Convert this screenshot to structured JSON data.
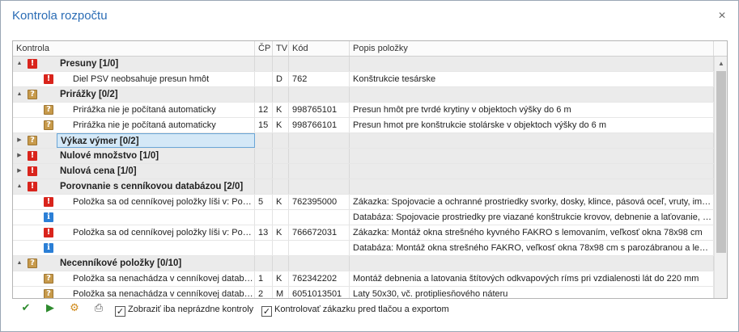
{
  "window": {
    "title": "Kontrola rozpočtu",
    "close_glyph": "×"
  },
  "grid": {
    "columns": [
      "Kontrola",
      "ČP",
      "TV",
      "Kód",
      "Popis položky"
    ],
    "rows": [
      {
        "kind": "group",
        "expand": "▲",
        "icon": "error",
        "text": "Presuny  [1/0]",
        "cp": "",
        "tv": "",
        "kod": "",
        "popis": ""
      },
      {
        "kind": "item",
        "expand": "",
        "icon": "error",
        "text": "Diel PSV neobsahuje presun hmôt",
        "cp": "",
        "tv": "D",
        "kod": "762",
        "popis": "Konštrukcie tesárske"
      },
      {
        "kind": "group",
        "expand": "▲",
        "icon": "warn",
        "text": "Prirážky  [0/2]",
        "cp": "",
        "tv": "",
        "kod": "",
        "popis": ""
      },
      {
        "kind": "item",
        "expand": "",
        "icon": "warn",
        "text": "Prirážka nie je  počítaná automaticky",
        "cp": "12",
        "tv": "K",
        "kod": "998765101",
        "popis": "Presun hmôt pre tvrdé krytiny v objektoch výšky do 6 m"
      },
      {
        "kind": "item",
        "expand": "",
        "icon": "warn",
        "text": "Prirážka nie je  počítaná automaticky",
        "cp": "15",
        "tv": "K",
        "kod": "998766101",
        "popis": "Presun hmot pre konštrukcie stolárske v objektoch výšky do 6 m"
      },
      {
        "kind": "group",
        "expand": "▶",
        "icon": "warn",
        "text": "Výkaz výmer  [0/2]",
        "cp": "",
        "tv": "",
        "kod": "",
        "popis": "",
        "selected": true
      },
      {
        "kind": "group",
        "expand": "▶",
        "icon": "error",
        "text": "Nulové množstvo  [1/0]",
        "cp": "",
        "tv": "",
        "kod": "",
        "popis": ""
      },
      {
        "kind": "group",
        "expand": "▶",
        "icon": "error",
        "text": "Nulová cena  [1/0]",
        "cp": "",
        "tv": "",
        "kod": "",
        "popis": ""
      },
      {
        "kind": "group",
        "expand": "▲",
        "icon": "error",
        "text": "Porovnanie s cenníkovou databázou  [2/0]",
        "cp": "",
        "tv": "",
        "kod": "",
        "popis": ""
      },
      {
        "kind": "item",
        "expand": "",
        "icon": "error",
        "text": "Položka sa od cenníkovej položky líši v: Popis položky",
        "cp": "5",
        "tv": "K",
        "kod": "762395000",
        "popis": "Zákazka: Spojovacie a ochranné prostriedky svorky, dosky, klince, pásová oceľ, vruty, impregnácia"
      },
      {
        "kind": "item",
        "expand": "",
        "icon": "info",
        "text": "",
        "cp": "",
        "tv": "",
        "kod": "",
        "popis": "Databáza: Spojovacie prostriedky  pre viazané konštrukcie krovov, debnenie a laťovanie, nadstrešné konštrukcie"
      },
      {
        "kind": "item",
        "expand": "",
        "icon": "error",
        "text": "Položka sa od cenníkovej položky líši v: Popis položky",
        "cp": "13",
        "tv": "K",
        "kod": "766672031",
        "popis": "Zákazka: Montáž okna strešného kyvného FAKRO s lemovaním, veľkosť okna 78x98 cm"
      },
      {
        "kind": "item",
        "expand": "",
        "icon": "info",
        "text": "",
        "cp": "",
        "tv": "",
        "kod": "",
        "popis": "Databáza: Montáž okna strešného FAKRO, veľkosť okna 78x98 cm s parozábranou a lemovaním"
      },
      {
        "kind": "group",
        "expand": "▲",
        "icon": "warn",
        "text": "Necenníkové položky   [0/10]",
        "cp": "",
        "tv": "",
        "kod": "",
        "popis": ""
      },
      {
        "kind": "item",
        "expand": "",
        "icon": "warn",
        "text": "Položka sa nenachádza v cenníkovej databáze",
        "cp": "1",
        "tv": "K",
        "kod": "762342202",
        "popis": "Montáž debnenia a latovania štítových odkvapových ríms pri vzdialenosti lát do 220 mm"
      },
      {
        "kind": "item",
        "expand": "",
        "icon": "warn",
        "text": "Položka sa nenachádza v cenníkovej databáze",
        "cp": "2",
        "tv": "M",
        "kod": "6051013501",
        "popis": "Laty 50x30, vč. protipliesňového náteru"
      }
    ]
  },
  "icons": {
    "error": "!",
    "warn": "?",
    "info": "i"
  },
  "toolbar": {
    "buttons": [
      {
        "name": "check-document-icon",
        "glyph": "✔",
        "color": "#2e8b2e"
      },
      {
        "name": "run-list-icon",
        "glyph": "▶",
        "color": "#2e8b2e"
      },
      {
        "name": "settings-gear-icon",
        "glyph": "⚙",
        "color": "#d08a1a"
      },
      {
        "name": "print-icon",
        "glyph": "⎙",
        "color": "#555555"
      }
    ],
    "check_nonempty_label": "Zobraziť iba neprázdne kontroly",
    "check_before_print_label": "Kontrolovať zákazku pred tlačou a exportom",
    "check_mark": "✓"
  }
}
